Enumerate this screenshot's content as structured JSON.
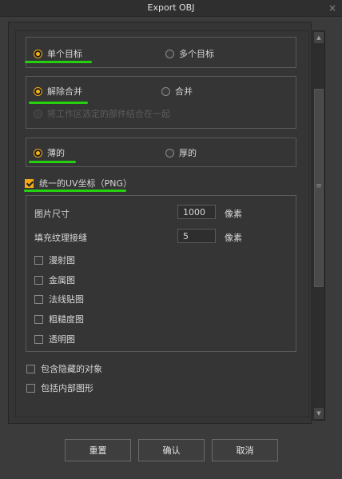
{
  "window": {
    "title": "Export OBJ",
    "close_glyph": "×"
  },
  "target": {
    "single_label": "单个目标",
    "multi_label": "多个目标",
    "selected": "single"
  },
  "merge": {
    "unmerge_label": "解除合并",
    "merge_label": "合并",
    "merge_selected_label": "将工作区选定的部件结合在一起"
  },
  "thickness": {
    "thin_label": "薄的",
    "thick_label": "厚的"
  },
  "uv": {
    "label": "统一的UV坐标（PNG）",
    "checked": true,
    "image_size_label": "图片尺寸",
    "image_size_value": "1000",
    "image_size_unit": "像素",
    "padding_label": "填充纹理接缝",
    "padding_value": "5",
    "padding_unit": "像素",
    "maps": [
      "漫射图",
      "金属图",
      "法线贴图",
      "粗糙度图",
      "透明图"
    ]
  },
  "options": {
    "include_hidden": "包含隐藏的对象",
    "include_inner": "包括内部图形"
  },
  "scrollbar": {
    "up_glyph": "▲",
    "down_glyph": "▼",
    "grip_glyph": "≡"
  },
  "buttons": {
    "reset": "重置",
    "confirm": "确认",
    "cancel": "取消"
  },
  "colors": {
    "accent": "#f6b31d",
    "highlight": "#25d10f"
  }
}
